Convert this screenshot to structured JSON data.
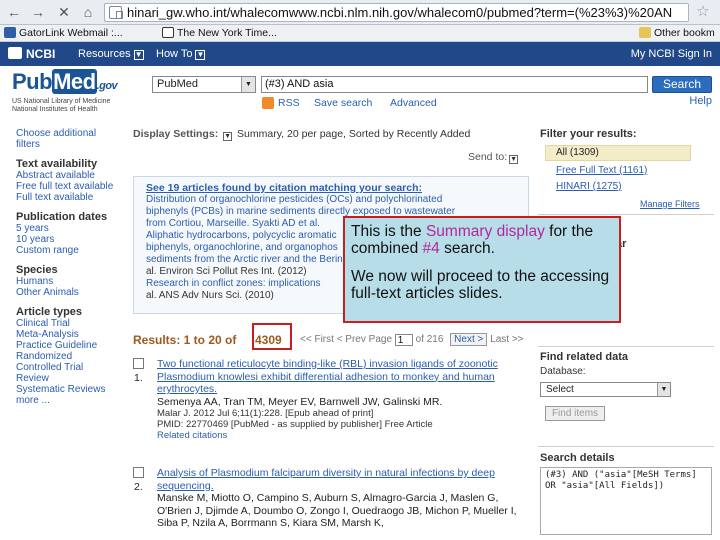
{
  "browser": {
    "back_icon": "back-arrow-icon",
    "forward_icon": "forward-arrow-icon",
    "url": "hinari_gw.who.int/whalecomwww.ncbi.nlm.nih.gov/whalecom0/pubmed?term=(%23%3)%20AN",
    "bookmarks": [
      "GatorLink Webmail :...",
      "The New York Time...",
      "Other bookm"
    ]
  },
  "ncbi_bar": {
    "logo": "NCBI",
    "resources": "Resources",
    "howto": "How To",
    "right": "My NCBI  Sign In"
  },
  "header": {
    "logo_word": "Pub",
    "logo_med": "Med",
    "logo_gov": ".gov",
    "org_line1": "US National Library of Medicine",
    "org_line2": "National Institutes of Health",
    "db_value": "PubMed",
    "search_value": "(#3) AND asia",
    "search_button": "Search",
    "rss": "RSS",
    "save_search": "Save search",
    "advanced": "Advanced",
    "help": "Help"
  },
  "left_filters": {
    "choose": "Choose additional filters",
    "text_head": "Text availability",
    "text_items": [
      "Abstract available",
      "Free full text available",
      "Full text available"
    ],
    "pub_head": "Publication dates",
    "pub_items": [
      "5 years",
      "10 years",
      "Custom range"
    ],
    "species_head": "Species",
    "species_items": [
      "Humans",
      "Other Animals"
    ],
    "article_head": "Article types",
    "article_items": [
      "Clinical Trial",
      "Meta-Analysis",
      "Practice Guideline",
      "Randomized Controlled Trial",
      "Review",
      "Systematic Reviews",
      "more ..."
    ]
  },
  "display": {
    "label": "Display Settings:",
    "value": "Summary, 20 per page, Sorted by Recently Added",
    "send_to": "Send to:"
  },
  "citation_box": {
    "heading": "See 19 articles found by citation matching your search:",
    "lines": [
      "Distribution of organochlorine pesticides (OCs) and polychlorinated",
      "biphenyls (PCBs) in marine sediments directly exposed to wastewater",
      "from Cortiou, Marseille. Syakti AD et al.",
      "Aliphatic hydrocarbons, polycyclic aromatic",
      "biphenyls, organochlorine, and organophos",
      "sediments from the Arctic river and the Bering",
      "al. Environ Sci Pollut Res Int. (2012)",
      "Research in conflict zones: implications",
      "al. ANS Adv Nurs Sci. (2010)"
    ]
  },
  "results": {
    "label": "Results: 1 to 20 of",
    "count": "4309",
    "first": "<< First",
    "prev": "< Prev",
    "page_label": "Page",
    "page_value": "1",
    "page_of": "of 216",
    "next": "Next >",
    "last": "Last >>",
    "items": [
      {
        "num": "1.",
        "title": "Two functional reticulocyte binding-like (RBL) invasion ligands of zoonotic Plasmodium knowlesi exhibit differential adhesion to monkey and human erythrocytes.",
        "authors": "Semenya AA, Tran TM, Meyer EV, Barnwell JW, Galinski MR.",
        "src": "Malar J. 2012 Jul 6;11(1):228. [Epub ahead of print]",
        "pmid": "PMID: 22770469 [PubMed - as supplied by publisher]   Free Article",
        "related": "Related citations"
      },
      {
        "num": "2.",
        "title": "Analysis of Plasmodium falciparum diversity in natural infections by deep sequencing.",
        "authors": "Manske M, Miotto O, Campino S, Auburn S, Almagro-Garcia J, Maslen G, O'Brien J, Djimde A, Doumbo O, Zongo I, Ouedraogo JB, Michon P, Mueller I, Siba P, Nzila A, Borrmann S, Kiara SM, Marsh K,",
        "src": "",
        "pmid": "",
        "related": ""
      }
    ]
  },
  "right_panel": {
    "filter_head": "Filter your results:",
    "filter_active": "All (1309)",
    "filter_items": [
      "Free Full Text (1161)",
      "HINARI (1275)"
    ],
    "manage": "Manage Filters",
    "titles_stub": "ar",
    "find_related": "Find related data",
    "database_label": "Database:",
    "database_select": "Select",
    "find_items": "Find items",
    "search_details": "Search details",
    "details_text": "(#3) AND (\"asia\"[MeSH Terms] OR \"asia\"[All Fields])"
  },
  "callout": {
    "p1_a": "This is the ",
    "p1_hl": "Summary display",
    "p1_b": " for the combined ",
    "p1_num": "#4",
    "p1_c": " search.",
    "p2": "We now will proceed to the accessing full-text articles slides."
  },
  "colors": {
    "ncbi_bar": "#21498a",
    "link": "#2a5db0",
    "callout_bg": "#b7dde8",
    "callout_border": "#c81e1e",
    "callout_highlight": "#b3289a",
    "results_heading": "#9b5a20"
  }
}
